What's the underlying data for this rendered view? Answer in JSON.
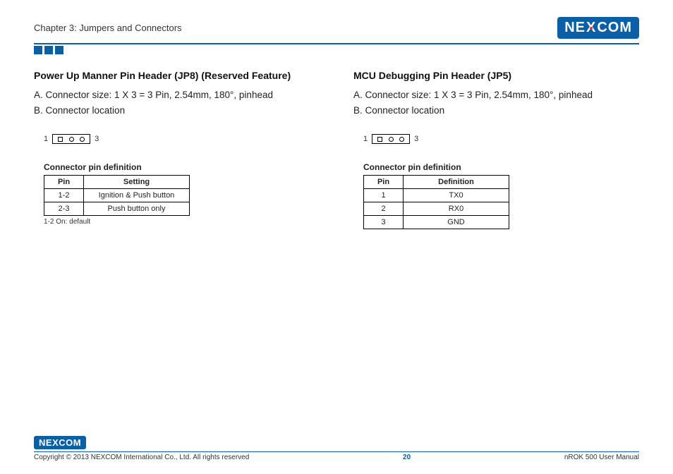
{
  "header": {
    "chapter": "Chapter 3: Jumpers and Connectors",
    "logo_text_left": "NE",
    "logo_text_x": "X",
    "logo_text_right": "COM"
  },
  "left": {
    "title": "Power Up Manner Pin Header (JP8) (Reserved Feature)",
    "lineA": "A. Connector size: 1 X 3 = 3 Pin, 2.54mm, 180°, pinhead",
    "lineB": "B. Connector location",
    "pin_left_label": "1",
    "pin_right_label": "3",
    "subheading": "Connector pin definition",
    "table": {
      "head": [
        "Pin",
        "Setting"
      ],
      "rows": [
        [
          "1-2",
          "Ignition & Push button"
        ],
        [
          "2-3",
          "Push button only"
        ]
      ]
    },
    "footnote": "1-2 On: default"
  },
  "right": {
    "title": "MCU Debugging Pin Header (JP5)",
    "lineA": "A. Connector size: 1 X 3 = 3 Pin, 2.54mm, 180°, pinhead",
    "lineB": "B. Connector location",
    "pin_left_label": "1",
    "pin_right_label": "3",
    "subheading": "Connector pin definition",
    "table": {
      "head": [
        "Pin",
        "Definition"
      ],
      "rows": [
        [
          "1",
          "TX0"
        ],
        [
          "2",
          "RX0"
        ],
        [
          "3",
          "GND"
        ]
      ]
    }
  },
  "footer": {
    "copyright": "Copyright © 2013 NEXCOM International Co., Ltd. All rights reserved",
    "page_number": "20",
    "doc_title": "nROK 500 User Manual"
  }
}
